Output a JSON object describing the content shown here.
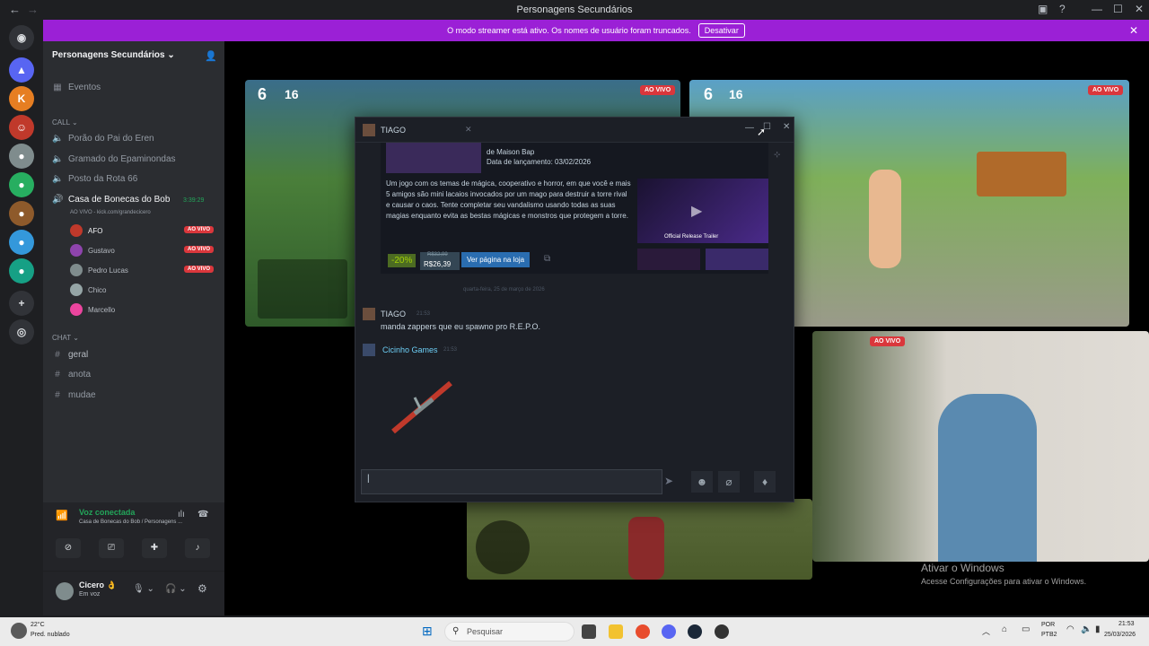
{
  "window": {
    "title": "Personagens Secundários"
  },
  "banner": {
    "text": "O modo streamer está ativo. Os nomes de usuário foram truncados.",
    "button": "Desativar"
  },
  "guild": {
    "name": "Personagens Secundários"
  },
  "channels": {
    "events": "Eventos",
    "call_category": "CALL",
    "voice": [
      "Porão do Pai do Eren",
      "Gramado do Epaminondas",
      "Posto da Rota 66"
    ],
    "active_voice": {
      "name": "Casa de Bonecas do Bob",
      "time": "3:39:29",
      "status": "AO VIVO - kick.com/grandecicero"
    },
    "users": [
      {
        "name": "AFO",
        "live": "AO VIVO"
      },
      {
        "name": "Gustavo",
        "live": "AO VIVO"
      },
      {
        "name": "Pedro Lucas",
        "live": "AO VIVO"
      },
      {
        "name": "Chico",
        "live": ""
      },
      {
        "name": "Marcello",
        "live": ""
      }
    ],
    "chat_category": "CHAT",
    "text": [
      "geral",
      "anota",
      "mudae"
    ]
  },
  "voice_panel": {
    "status": "Voz conectada",
    "location": "Casa de Bonecas do Bob / Personagens ..."
  },
  "user_panel": {
    "name": "Cicero",
    "status": "Em voz"
  },
  "streams": {
    "live_label": "AO VIVO",
    "hud_left": "6",
    "hud_kills": "16"
  },
  "popup": {
    "sender": "TIAGO",
    "game_dev": "de Maison Bap",
    "release": "Data de lançamento: 03/02/2026",
    "description": "Um jogo com os temas de mágica, cooperativo e horror, em que você e mais 5 amigos são mini lacaios invocados por um mago para destruir a torre rival e causar o caos. Tente completar seu vandalismo usando todas as suas magias enquanto evita as bestas mágicas e monstros que protegem a torre.",
    "discount": "-20%",
    "old_price": "R$32,99",
    "price": "R$26,39",
    "store_button": "Ver página na loja",
    "trailer": "Official Release Trailer",
    "date_divider": "quarta-feira, 25 de março de 2026",
    "msg1_name": "TIAGO",
    "msg1_time": "21:53",
    "msg1_text": "manda zappers que eu spawno pro R.E.P.O.",
    "msg2_name": "Cicinho Games",
    "msg2_time": "21:53"
  },
  "windows_activation": {
    "line1": "Ativar o Windows",
    "line2": "Acesse Configurações para ativar o Windows."
  },
  "taskbar": {
    "weather_temp": "22°C",
    "weather_desc": "Pred. nublado",
    "search": "Pesquisar",
    "lang": "POR",
    "layout": "PTB2",
    "time": "21:53",
    "date": "25/03/2026"
  },
  "colors": {
    "accent": "#9b20d6",
    "live": "#da373c",
    "steam_green": "#4c6b22",
    "steam_blue": "#2a6db0"
  }
}
